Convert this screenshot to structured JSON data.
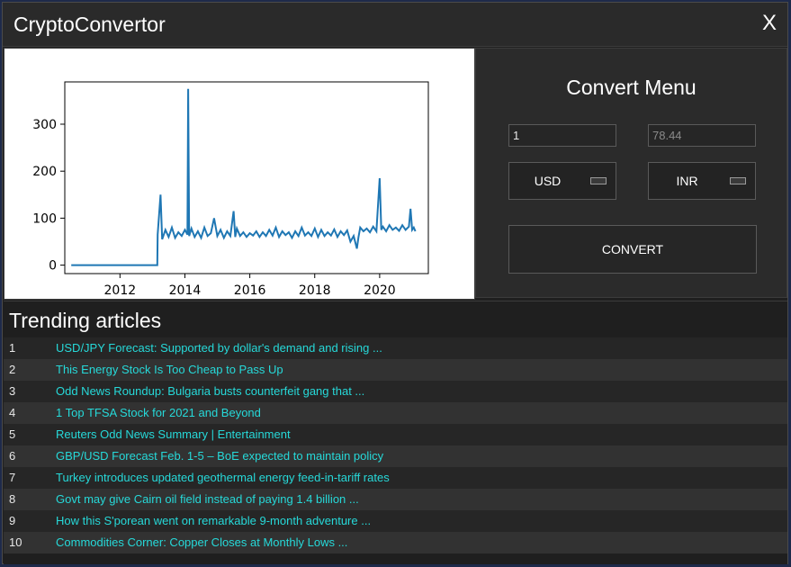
{
  "app": {
    "title": "CryptoConvertor",
    "close_label": "X"
  },
  "chart_data": {
    "type": "line",
    "xlim": [
      2010.3,
      2021.5
    ],
    "ylim": [
      -18,
      390
    ],
    "xticks": [
      2012,
      2014,
      2016,
      2018,
      2020
    ],
    "yticks": [
      0,
      100,
      200,
      300
    ],
    "color": "#1f77b4",
    "series": [
      {
        "values": [
          [
            2010.5,
            0
          ],
          [
            2013.1,
            0
          ],
          [
            2013.15,
            0
          ],
          [
            2013.16,
            65
          ],
          [
            2013.25,
            150
          ],
          [
            2013.3,
            55
          ],
          [
            2013.4,
            75
          ],
          [
            2013.5,
            60
          ],
          [
            2013.6,
            80
          ],
          [
            2013.7,
            58
          ],
          [
            2013.8,
            70
          ],
          [
            2013.9,
            62
          ],
          [
            2014.0,
            75
          ],
          [
            2014.08,
            65
          ],
          [
            2014.1,
            375
          ],
          [
            2014.13,
            62
          ],
          [
            2014.2,
            78
          ],
          [
            2014.3,
            60
          ],
          [
            2014.4,
            72
          ],
          [
            2014.5,
            58
          ],
          [
            2014.6,
            80
          ],
          [
            2014.7,
            62
          ],
          [
            2014.8,
            68
          ],
          [
            2014.9,
            100
          ],
          [
            2015.0,
            62
          ],
          [
            2015.1,
            75
          ],
          [
            2015.2,
            58
          ],
          [
            2015.3,
            72
          ],
          [
            2015.4,
            62
          ],
          [
            2015.5,
            115
          ],
          [
            2015.55,
            60
          ],
          [
            2015.6,
            78
          ],
          [
            2015.7,
            62
          ],
          [
            2015.8,
            70
          ],
          [
            2015.9,
            60
          ],
          [
            2016.0,
            68
          ],
          [
            2016.1,
            63
          ],
          [
            2016.2,
            72
          ],
          [
            2016.3,
            60
          ],
          [
            2016.4,
            70
          ],
          [
            2016.5,
            62
          ],
          [
            2016.6,
            75
          ],
          [
            2016.7,
            63
          ],
          [
            2016.8,
            80
          ],
          [
            2016.9,
            60
          ],
          [
            2017.0,
            72
          ],
          [
            2017.1,
            64
          ],
          [
            2017.2,
            70
          ],
          [
            2017.3,
            58
          ],
          [
            2017.4,
            72
          ],
          [
            2017.5,
            62
          ],
          [
            2017.6,
            80
          ],
          [
            2017.7,
            63
          ],
          [
            2017.8,
            70
          ],
          [
            2017.9,
            62
          ],
          [
            2018.0,
            78
          ],
          [
            2018.1,
            60
          ],
          [
            2018.2,
            75
          ],
          [
            2018.3,
            62
          ],
          [
            2018.4,
            70
          ],
          [
            2018.5,
            63
          ],
          [
            2018.6,
            76
          ],
          [
            2018.7,
            60
          ],
          [
            2018.8,
            72
          ],
          [
            2018.9,
            64
          ],
          [
            2019.0,
            74
          ],
          [
            2019.1,
            50
          ],
          [
            2019.2,
            62
          ],
          [
            2019.3,
            35
          ],
          [
            2019.35,
            60
          ],
          [
            2019.4,
            80
          ],
          [
            2019.5,
            72
          ],
          [
            2019.6,
            78
          ],
          [
            2019.7,
            70
          ],
          [
            2019.8,
            82
          ],
          [
            2019.9,
            72
          ],
          [
            2020.0,
            185
          ],
          [
            2020.05,
            75
          ],
          [
            2020.1,
            82
          ],
          [
            2020.2,
            72
          ],
          [
            2020.3,
            85
          ],
          [
            2020.4,
            75
          ],
          [
            2020.5,
            80
          ],
          [
            2020.6,
            73
          ],
          [
            2020.7,
            85
          ],
          [
            2020.8,
            75
          ],
          [
            2020.9,
            82
          ],
          [
            2020.95,
            120
          ],
          [
            2021.0,
            75
          ],
          [
            2021.05,
            80
          ],
          [
            2021.1,
            72
          ]
        ]
      }
    ]
  },
  "converter": {
    "title": "Convert Menu",
    "from_value": "1",
    "to_value": "78.44",
    "from_currency": "USD",
    "to_currency": "INR",
    "convert_label": "CONVERT"
  },
  "articles": {
    "title": "Trending articles",
    "items": [
      {
        "num": "1",
        "title": "USD/JPY Forecast: Supported by dollar's demand and rising ..."
      },
      {
        "num": "2",
        "title": "This Energy Stock Is Too Cheap to Pass Up"
      },
      {
        "num": "3",
        "title": "Odd News Roundup: Bulgaria busts counterfeit gang that ..."
      },
      {
        "num": "4",
        "title": "1 Top TFSA Stock for 2021 and Beyond"
      },
      {
        "num": "5",
        "title": "Reuters Odd News Summary | Entertainment"
      },
      {
        "num": "6",
        "title": "GBP/USD Forecast Feb. 1-5 – BoE expected to maintain policy"
      },
      {
        "num": "7",
        "title": "Turkey introduces updated geothermal energy feed-in-tariff rates"
      },
      {
        "num": "8",
        "title": "Govt may give Cairn oil field instead of paying 1.4 billion ..."
      },
      {
        "num": "9",
        "title": "How this S'porean went on remarkable 9-month adventure ..."
      },
      {
        "num": "10",
        "title": "Commodities Corner: Copper Closes at Monthly Lows ..."
      }
    ]
  }
}
